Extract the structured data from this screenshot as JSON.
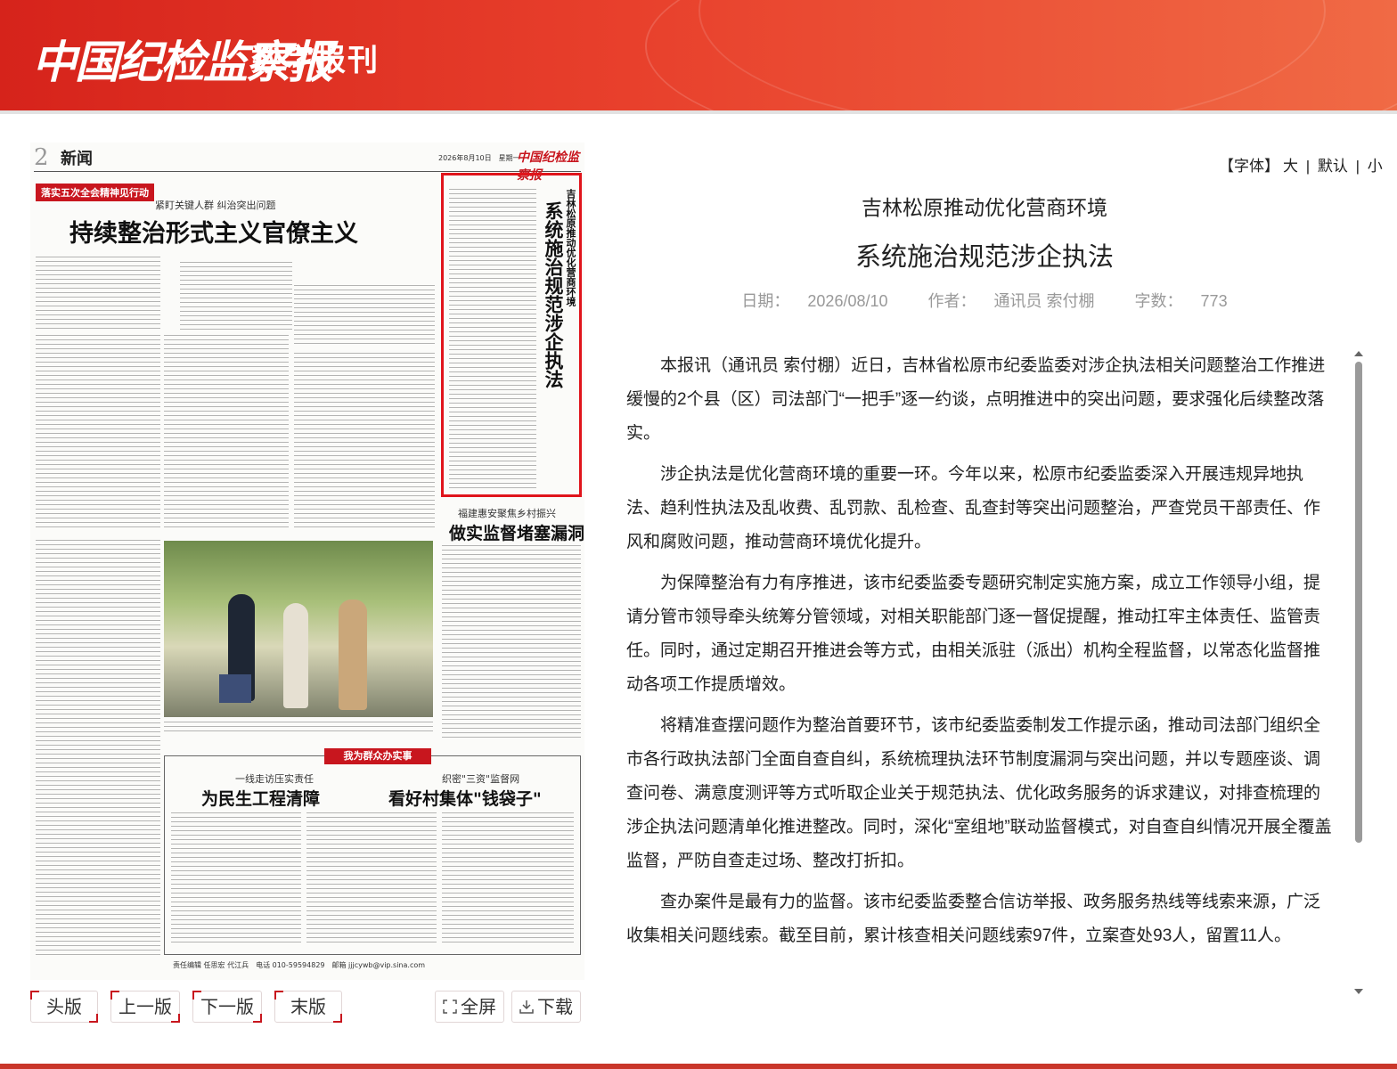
{
  "header": {
    "logo_text": "中国纪检监察报",
    "subtitle": "数字报刊"
  },
  "newspaper": {
    "page_number": "2",
    "section": "新闻",
    "date_line": "2026年8月10日　星期一",
    "masthead": "中国纪检监察报",
    "tag": "落实五次全会精神见行动",
    "kicker_main": "紧盯关键人群 纠治突出问题",
    "headline_main": "持续整治形式主义官僚主义",
    "red_box_subtitle": "吉林松原推动优化营商环境",
    "red_box_title": "系统施治规范涉企执法",
    "kicker_right": "福建惠安聚焦乡村振兴",
    "headline_right": "做实监督堵塞漏洞",
    "banner": "我为群众办实事",
    "kicker_left_box": "一线走访压实责任",
    "headline_left_box": "为民生工程清障",
    "kicker_right_box": "织密\"三资\"监督网",
    "headline_right_box": "看好村集体\"钱袋子\"",
    "footer_line": "责任编辑 任思宏 代江兵　电话 010-59594829　邮箱 jjjcywb@vip.sina.com"
  },
  "buttons": {
    "first": "头版",
    "prev": "上一版",
    "next": "下一版",
    "last": "末版",
    "fullscreen": "全屏",
    "download": "下载"
  },
  "font_controls": {
    "label": "【字体】",
    "large": "大",
    "sep1": "|",
    "default": "默认",
    "sep2": "|",
    "small": "小"
  },
  "article": {
    "supertitle": "吉林松原推动优化营商环境",
    "title": "系统施治规范涉企执法",
    "date_label": "日期：",
    "date_value": "2026/08/10",
    "author_label": "作者：",
    "author_value": "通讯员 索付棚",
    "wordcount_label": "字数：",
    "wordcount_value": "773",
    "paragraphs": [
      "本报讯（通讯员 索付棚）近日，吉林省松原市纪委监委对涉企执法相关问题整治工作推进缓慢的2个县（区）司法部门“一把手”逐一约谈，点明推进中的突出问题，要求强化后续整改落实。",
      "涉企执法是优化营商环境的重要一环。今年以来，松原市纪委监委深入开展违规异地执法、趋利性执法及乱收费、乱罚款、乱检查、乱查封等突出问题整治，严查党员干部责任、作风和腐败问题，推动营商环境优化提升。",
      "为保障整治有力有序推进，该市纪委监委专题研究制定实施方案，成立工作领导小组，提请分管市领导牵头统筹分管领域，对相关职能部门逐一督促提醒，推动扛牢主体责任、监管责任。同时，通过定期召开推进会等方式，由相关派驻（派出）机构全程监督，以常态化监督推动各项工作提质增效。",
      "将精准查摆问题作为整治首要环节，该市纪委监委制发工作提示函，推动司法部门组织全市各行政执法部门全面自查自纠，系统梳理执法环节制度漏洞与突出问题，并以专题座谈、调查问卷、满意度测评等方式听取企业关于规范执法、优化政务服务的诉求建议，对排查梳理的涉企执法问题清单化推进整改。同时，深化“室组地”联动监督模式，对自查自纠情况开展全覆盖监督，严防自查走过场、整改打折扣。",
      "查办案件是最有力的监督。该市纪委监委整合信访举报、政务服务热线等线索来源，广泛收集相关问题线索。截至目前，累计核查相关问题线索97件，立案查处93人，留置11人。"
    ]
  },
  "colors": {
    "brand_red": "#c8161e",
    "header_red": "#e8402c",
    "meta_gray": "#999999"
  }
}
